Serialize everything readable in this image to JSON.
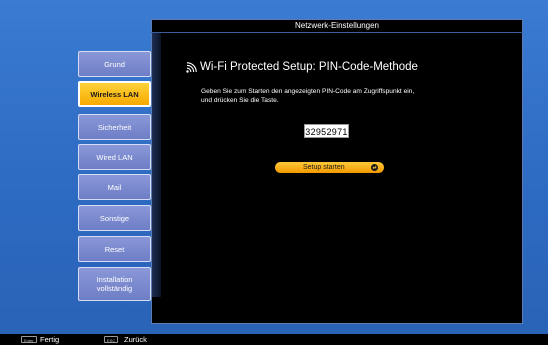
{
  "window": {
    "title": "Netzwerk-Einstellungen"
  },
  "sidebar": {
    "items": [
      {
        "label": "Grund"
      },
      {
        "label": "Wireless LAN"
      },
      {
        "label": "Sicherheit"
      },
      {
        "label": "Wired LAN"
      },
      {
        "label": "Mail"
      },
      {
        "label": "Sonstige"
      },
      {
        "label": "Reset"
      },
      {
        "label": "Installation vollständig"
      }
    ],
    "active_index": 1
  },
  "main": {
    "heading": "Wi-Fi Protected Setup: PIN-Code-Methode",
    "heading_icon": "wifi-icon",
    "description_line1": "Geben Sie zum Starten den angezeigten PIN-Code am Zugriffspunkt ein,",
    "description_line2": "und drücken Sie die Taste.",
    "pin_code": "32952971",
    "setup_button": "Setup starten",
    "setup_button_icon": "enter-icon"
  },
  "footer": {
    "enter_key": "Enter",
    "enter_label": "Fertig",
    "esc_key": "ESC",
    "esc_label": "Zurück"
  },
  "colors": {
    "background": "#2f6fc6",
    "panel": "#000000",
    "menu_button": "#7a89cf",
    "active_button": "#ffc21a",
    "setup_button": "#f6aa12"
  }
}
